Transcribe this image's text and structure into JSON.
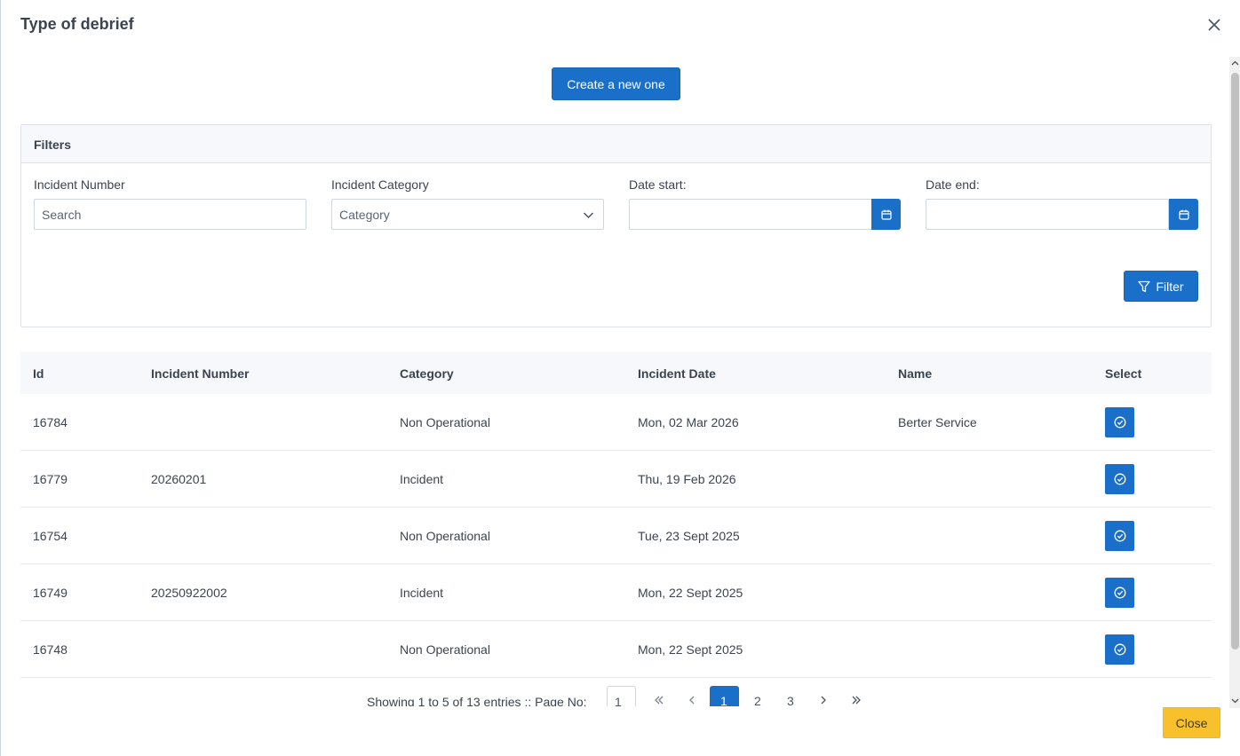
{
  "modal": {
    "title": "Type of debrief",
    "create_label": "Create a new one",
    "close_label": "Close"
  },
  "filters": {
    "heading": "Filters",
    "incident_number_label": "Incident Number",
    "incident_number_placeholder": "Search",
    "category_label": "Incident Category",
    "category_value": "Category",
    "date_start_label": "Date start:",
    "date_end_label": "Date end:",
    "filter_label": "Filter"
  },
  "table": {
    "columns": [
      "Id",
      "Incident Number",
      "Category",
      "Incident Date",
      "Name",
      "Select"
    ],
    "rows": [
      {
        "id": "16784",
        "number": "",
        "category": "Non Operational",
        "date": "Mon, 02 Mar 2026",
        "name": "Berter Service"
      },
      {
        "id": "16779",
        "number": "20260201",
        "category": "Incident",
        "date": "Thu, 19 Feb 2026",
        "name": ""
      },
      {
        "id": "16754",
        "number": "",
        "category": "Non Operational",
        "date": "Tue, 23 Sept 2025",
        "name": ""
      },
      {
        "id": "16749",
        "number": "20250922002",
        "category": "Incident",
        "date": "Mon, 22 Sept 2025",
        "name": ""
      },
      {
        "id": "16748",
        "number": "",
        "category": "Non Operational",
        "date": "Mon, 22 Sept 2025",
        "name": ""
      }
    ]
  },
  "pager": {
    "summary": "Showing 1 to 5 of 13 entries :: Page No:",
    "page_input": "1",
    "pages": [
      "1",
      "2",
      "3"
    ]
  },
  "icons": {
    "close": "close-icon",
    "calendar": "calendar-icon",
    "filter": "funnel-icon",
    "select": "check-circle-icon",
    "chevron": "chevron-down-icon"
  },
  "colors": {
    "primary": "#1a6fc9",
    "close_button": "#f8c12c"
  }
}
